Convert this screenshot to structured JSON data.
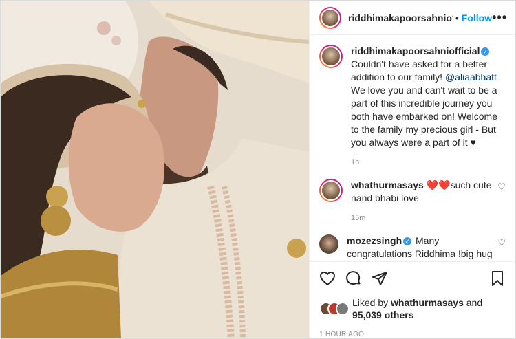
{
  "post": {
    "username": "riddhimakapoorsahniofficial",
    "header_username": "riddhimakapoorsahniofficial",
    "follow_label": "Follow",
    "more_label": "•••",
    "dot": "•"
  },
  "caption": {
    "username": "riddhimakapoorsahniofficial",
    "text_before": " Couldn't have asked for a better addition to our family! ",
    "mention": "@aliaabhatt",
    "text_after": " We love you and can't wait to be a part of this incredible journey you both have embarked on! Welcome to the family my precious girl - But you always were a part of it ♥",
    "time": "1h"
  },
  "comments": [
    {
      "username": "whathurmasays",
      "text": "such cute nand bhabi love",
      "emoji": "❤️❤️",
      "time": "15m"
    },
    {
      "username": "mozezsingh",
      "text": " Many congratulations Riddhima !big hug",
      "emoji": "😍❤️"
    }
  ],
  "likes": {
    "prefix": "Liked by ",
    "user": "whathurmasays",
    "middle": " and",
    "count": "95,039 others"
  },
  "timestamp": "1 HOUR AGO",
  "icons": [
    "like-icon",
    "comment-icon",
    "share-icon",
    "save-icon"
  ],
  "colors": {
    "accent": "#0095f6",
    "verified": "#3897f0",
    "muted": "#8e8e8e",
    "heart": "#ed4956"
  }
}
